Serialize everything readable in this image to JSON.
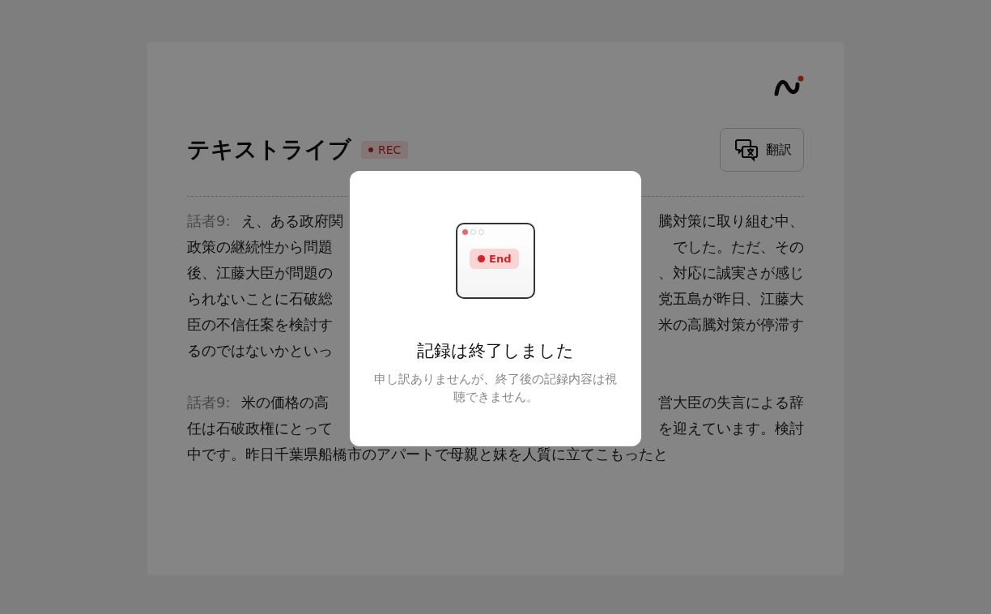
{
  "header": {
    "title": "テキストライブ",
    "badge": "REC",
    "translate_button": "翻訳"
  },
  "transcript": [
    {
      "speaker": "話者9:",
      "lines": [
        {
          "left": "え、ある政府関",
          "right": "騰対策に取り組む中、"
        },
        {
          "left": "政策の継続性から問題",
          "right": "でした。ただ、その"
        },
        {
          "left": "後、江藤大臣が問題の",
          "right": "、対応に誠実さが感じ"
        },
        {
          "left": "られないことに石破総",
          "right": "党五島が昨日、江藤大"
        },
        {
          "left": "臣の不信任案を検討す",
          "right": "米の高騰対策が停滞す"
        },
        {
          "left": "るのではないかといっ"
        }
      ]
    },
    {
      "speaker": "話者9:",
      "lines": [
        {
          "left": "米の価格の高",
          "right": "営大臣の失言による辞"
        },
        {
          "left": "任は石破政権にとって",
          "right": "を迎えています。検討"
        },
        {
          "left": "中です。昨日千葉県船橋市のアパートで母親と妹を人質に立てこもったと"
        }
      ]
    }
  ],
  "dialog": {
    "badge": "End",
    "title": "記録は終了しました",
    "message": "申し訳ありませんが、終了後の記録内容は視聴できません。"
  }
}
